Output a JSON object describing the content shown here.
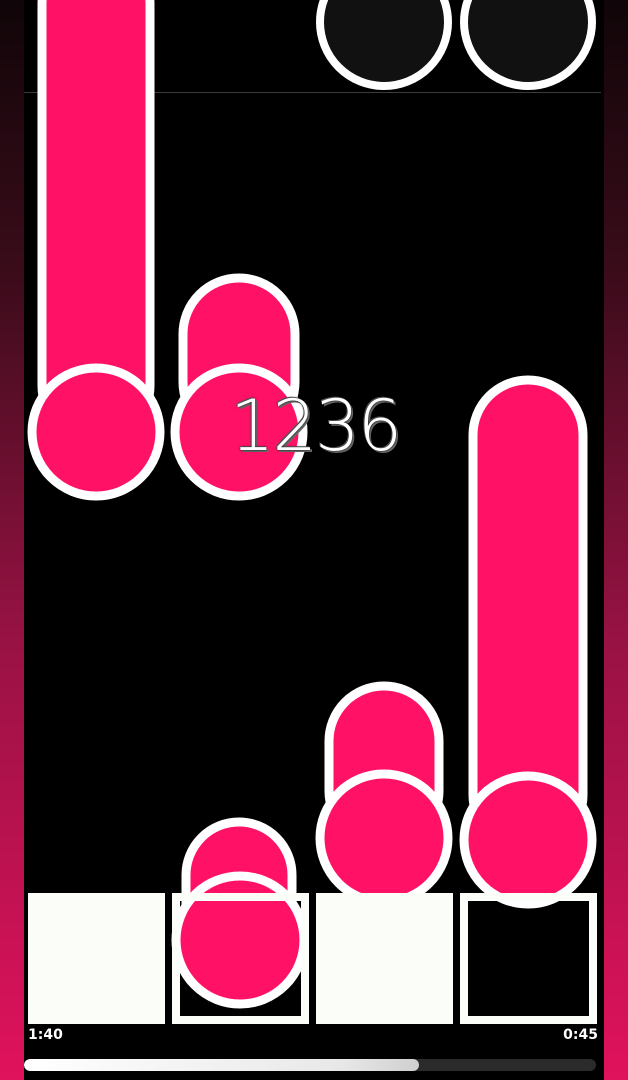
{
  "colors": {
    "note_fill": "#ff1166",
    "note_outline": "#ffffff",
    "background": "#000000",
    "tile_fill": "#fbfdf9",
    "side_gradient_bottom": "#e0125c"
  },
  "hud": {
    "score": "1236",
    "elapsed_time": "1:40",
    "remaining_time": "0:45",
    "progress_fraction": 0.69
  },
  "lanes": {
    "count": 4,
    "tiles": [
      "filled",
      "hollow",
      "filled",
      "hollow"
    ]
  }
}
